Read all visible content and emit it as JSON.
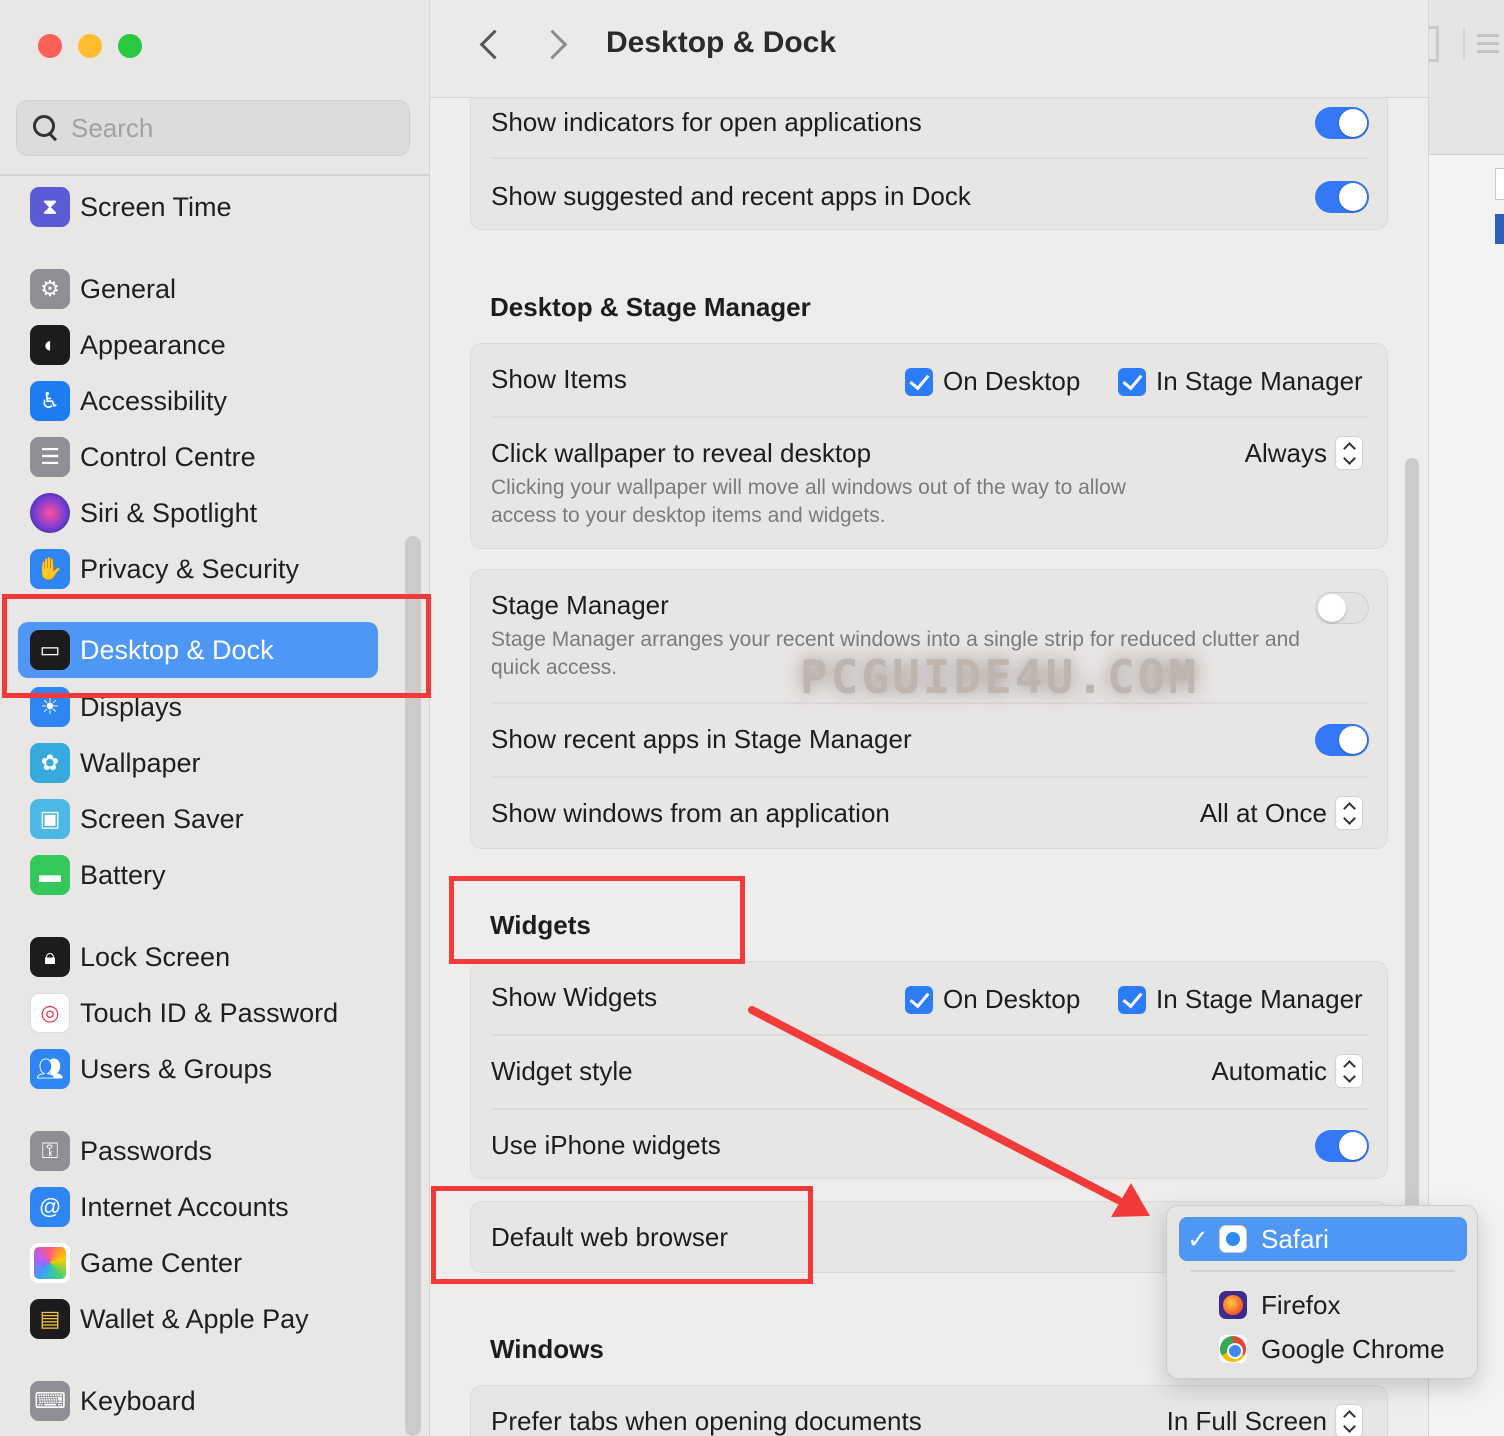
{
  "window": {
    "title": "Desktop & Dock"
  },
  "search": {
    "placeholder": "Search"
  },
  "sidebar": {
    "items": [
      {
        "label": "Screen Time",
        "icon": "hourglass-icon",
        "color": "#5b5bd6"
      },
      {
        "label": "General",
        "icon": "gear-icon",
        "color": "#8e8e93"
      },
      {
        "label": "Appearance",
        "icon": "appearance-icon",
        "color": "#1c1c1e"
      },
      {
        "label": "Accessibility",
        "icon": "accessibility-icon",
        "color": "#1e7cf2"
      },
      {
        "label": "Control Centre",
        "icon": "control-centre-icon",
        "color": "#8e8e93"
      },
      {
        "label": "Siri & Spotlight",
        "icon": "siri-icon",
        "color": "#6a3bd6"
      },
      {
        "label": "Privacy & Security",
        "icon": "hand-icon",
        "color": "#2e86f5"
      },
      {
        "label": "Desktop & Dock",
        "icon": "dock-icon",
        "color": "#1c1c1e"
      },
      {
        "label": "Displays",
        "icon": "sun-icon",
        "color": "#2e86f5"
      },
      {
        "label": "Wallpaper",
        "icon": "flower-icon",
        "color": "#36aadc"
      },
      {
        "label": "Screen Saver",
        "icon": "screen-saver-icon",
        "color": "#4cb8e6"
      },
      {
        "label": "Battery",
        "icon": "battery-icon",
        "color": "#34c759"
      },
      {
        "label": "Lock Screen",
        "icon": "lock-icon",
        "color": "#1c1c1e"
      },
      {
        "label": "Touch ID & Password",
        "icon": "fingerprint-icon",
        "color": "#ffffff"
      },
      {
        "label": "Users & Groups",
        "icon": "users-icon",
        "color": "#2e86f5"
      },
      {
        "label": "Passwords",
        "icon": "key-icon",
        "color": "#8e8e93"
      },
      {
        "label": "Internet Accounts",
        "icon": "at-icon",
        "color": "#2e86f5"
      },
      {
        "label": "Game Center",
        "icon": "game-center-icon",
        "color": "#ffffff"
      },
      {
        "label": "Wallet & Apple Pay",
        "icon": "wallet-icon",
        "color": "#1c1c1e"
      },
      {
        "label": "Keyboard",
        "icon": "keyboard-icon",
        "color": "#8e8e93"
      }
    ]
  },
  "dock": {
    "show_indicators": "Show indicators for open applications",
    "show_suggested": "Show suggested and recent apps in Dock"
  },
  "stage": {
    "heading": "Desktop & Stage Manager",
    "show_items": "Show Items",
    "on_desktop": "On Desktop",
    "in_stage_manager": "In Stage Manager",
    "click_wallpaper": "Click wallpaper to reveal desktop",
    "click_wallpaper_desc": "Clicking your wallpaper will move all windows out of the way to allow access to your desktop items and widgets.",
    "click_wallpaper_value": "Always",
    "stage_manager": "Stage Manager",
    "stage_manager_desc": "Stage Manager arranges your recent windows into a single strip for reduced clutter and quick access.",
    "show_recent": "Show recent apps in Stage Manager",
    "show_windows": "Show windows from an application",
    "show_windows_value": "All at Once"
  },
  "widgets": {
    "heading": "Widgets",
    "show_widgets": "Show Widgets",
    "on_desktop": "On Desktop",
    "in_stage_manager": "In Stage Manager",
    "widget_style": "Widget style",
    "widget_style_value": "Automatic",
    "use_iphone": "Use iPhone widgets",
    "default_browser": "Default web browser"
  },
  "windows": {
    "heading": "Windows",
    "prefer_tabs": "Prefer tabs when opening documents",
    "prefer_tabs_value": "In Full Screen"
  },
  "browser_menu": {
    "selected": "Safari",
    "options": [
      "Safari",
      "Firefox",
      "Google Chrome"
    ],
    "check": "✓"
  },
  "watermark": "PCGUIDE4U.COM",
  "colors": {
    "accent": "#3478f6",
    "annotation": "#f23a3a",
    "selection": "#4f97f5"
  }
}
